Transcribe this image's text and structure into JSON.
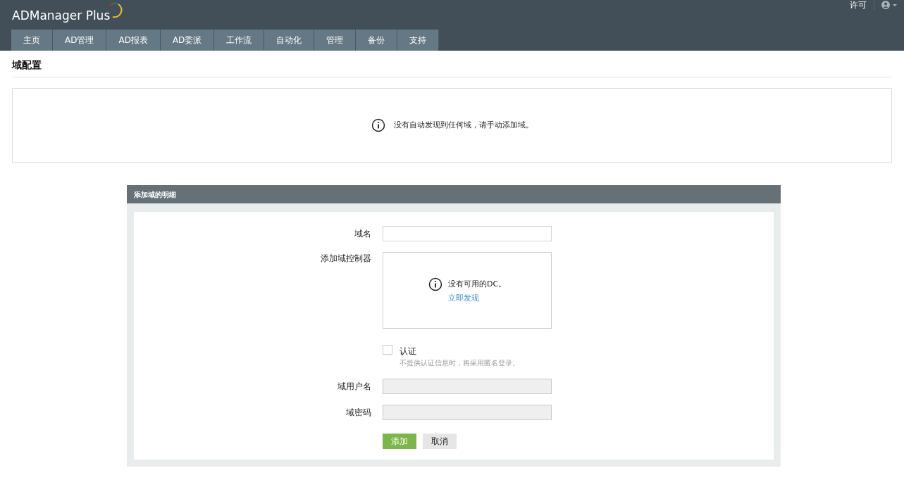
{
  "header": {
    "logo": "ADManager Plus",
    "license_link": "许可"
  },
  "tabs": [
    {
      "label": "主页",
      "selected": false
    },
    {
      "label": "AD管理",
      "selected": false
    },
    {
      "label": "AD报表",
      "selected": false
    },
    {
      "label": "AD委派",
      "selected": false
    },
    {
      "label": "工作流",
      "selected": false
    },
    {
      "label": "自动化",
      "selected": false
    },
    {
      "label": "管理",
      "selected": false
    },
    {
      "label": "备份",
      "selected": false
    },
    {
      "label": "支持",
      "selected": false
    }
  ],
  "page_title": "域配置",
  "notice": "没有自动发现到任何域，请手动添加域。",
  "form": {
    "title": "添加域的明细",
    "domain_name": {
      "label": "域名"
    },
    "dc": {
      "label": "添加域控制器",
      "message": "没有可用的DC。",
      "link": "立即发现"
    },
    "auth": {
      "label": "认证",
      "checked": false,
      "hint": "不提供认证信息时，将采用匿名登录。"
    },
    "username": {
      "label": "域用户名",
      "disabled": true
    },
    "password": {
      "label": "域密码",
      "disabled": true
    },
    "buttons": [
      {
        "label": "添加",
        "kind": "primary"
      },
      {
        "label": "取消",
        "kind": "secondary"
      }
    ]
  }
}
